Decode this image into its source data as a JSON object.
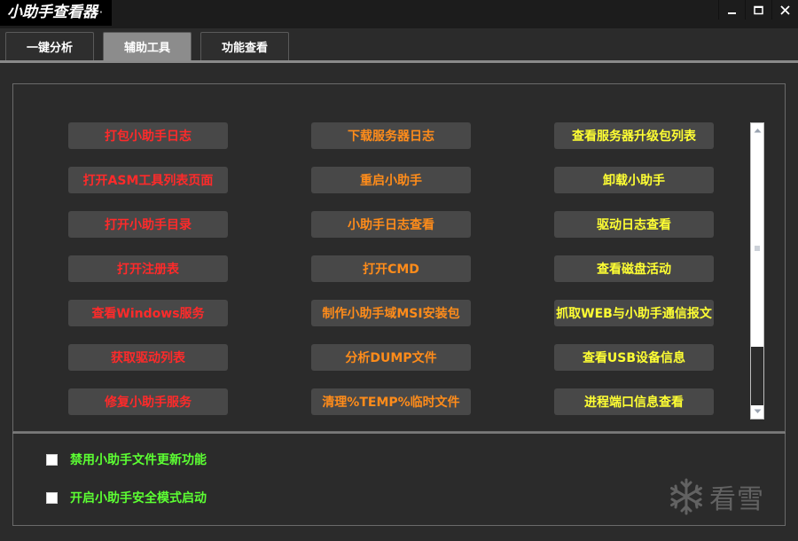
{
  "window": {
    "title": "小助手查看器",
    "title_dot": "·",
    "controls": {
      "minimize": "minimize-icon",
      "maximize": "maximize-icon",
      "close": "close-icon"
    }
  },
  "tabs": [
    {
      "label": "一键分析",
      "active": false
    },
    {
      "label": "辅助工具",
      "active": true
    },
    {
      "label": "功能查看",
      "active": false
    }
  ],
  "tools": {
    "col1": [
      "打包小助手日志",
      "打开ASM工具列表页面",
      "打开小助手目录",
      "打开注册表",
      "查看Windows服务",
      "获取驱动列表",
      "修复小助手服务"
    ],
    "col2": [
      "下载服务器日志",
      "重启小助手",
      "小助手日志查看",
      "打开CMD",
      "制作小助手域MSI安装包",
      "分析DUMP文件",
      "清理%TEMP%临时文件"
    ],
    "col3": [
      "查看服务器升级包列表",
      "卸载小助手",
      "驱动日志查看",
      "查看磁盘活动",
      "抓取WEB与小助手通信报文",
      "查看USB设备信息",
      "进程端口信息查看"
    ]
  },
  "options": [
    {
      "label": "禁用小助手文件更新功能",
      "checked": false
    },
    {
      "label": "开启小助手安全模式启动",
      "checked": false
    }
  ],
  "watermark": {
    "text": "看雪",
    "icon": "snowflake-icon"
  },
  "colors": {
    "col1_text": "#ff2a2a",
    "col2_text": "#ff8c1a",
    "col3_text": "#ffff33",
    "option_text": "#5cff33",
    "button_bg": "#484848",
    "background": "#2b2b2b"
  }
}
